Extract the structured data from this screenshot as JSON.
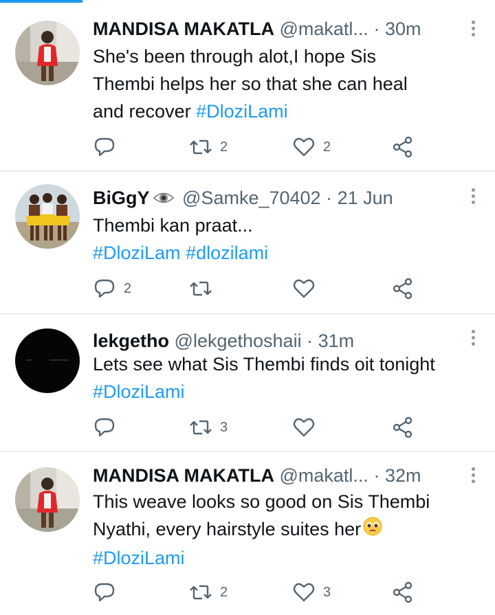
{
  "tweets": [
    {
      "name": "MANDISA MAKATLA",
      "handle": "@makatl...",
      "separator": "·",
      "time": "30m",
      "text_lines": [
        [
          {
            "text": "She's been through alot,I hope Sis",
            "tag": false
          }
        ],
        [
          {
            "text": "Thembi helps her so that she can heal",
            "tag": false
          }
        ],
        [
          {
            "text": "and recover ",
            "tag": false
          },
          {
            "text": "#DloziLami",
            "tag": true
          }
        ]
      ],
      "replies": "",
      "retweets": "2",
      "likes": "2"
    },
    {
      "name": "BiGgY",
      "name_emoji": "eye-icon",
      "handle": "@Samke_70402",
      "separator": "·",
      "time": "21 Jun",
      "text_lines": [
        [
          {
            "text": "Thembi kan praat...",
            "tag": false
          }
        ],
        [
          {
            "text": "#DloziLam",
            "tag": true
          },
          {
            "text": " ",
            "tag": false
          },
          {
            "text": "#dlozilami",
            "tag": true
          }
        ]
      ],
      "replies": "2",
      "retweets": "",
      "likes": ""
    },
    {
      "name": "lekgetho",
      "handle": "@lekgethoshaii",
      "separator": "·",
      "time": "31m",
      "text_lines": [
        [
          {
            "text": "Lets see what Sis Thembi finds oit tonight",
            "tag": false
          }
        ],
        [
          {
            "text": "#DloziLami",
            "tag": true
          }
        ]
      ],
      "replies": "",
      "retweets": "3",
      "likes": ""
    },
    {
      "name": "MANDISA MAKATLA",
      "handle": "@makatl...",
      "separator": "·",
      "time": "32m",
      "text_lines": [
        [
          {
            "text": "This weave looks so good on Sis Thembi",
            "tag": false
          }
        ],
        [
          {
            "text": "Nyathi, every hairstyle suites her",
            "tag": false
          },
          {
            "emoji": "pleading-face-icon"
          }
        ],
        [
          {
            "text": "#DloziLami",
            "tag": true
          }
        ]
      ],
      "replies": "",
      "retweets": "2",
      "likes": "3"
    }
  ],
  "colors": {
    "accent": "#1d9bf0",
    "text": "#0f1419",
    "secondary": "#536471",
    "divider": "#e6ecf0"
  }
}
